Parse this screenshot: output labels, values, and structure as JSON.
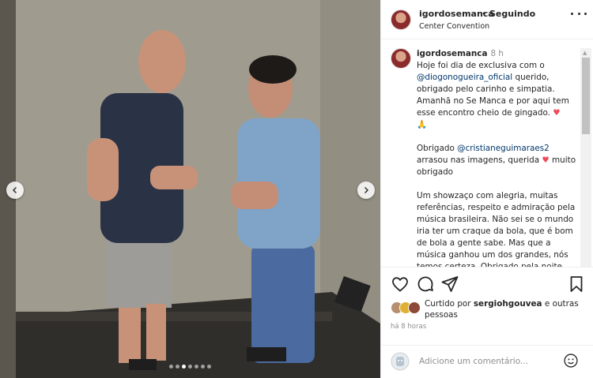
{
  "post": {
    "username": "igordosemanca",
    "separator": "•",
    "follow_status": "Seguindo",
    "location": "Center Convention"
  },
  "caption": {
    "username": "igordosemanca",
    "time": "8 h",
    "line1": "Hoje foi dia de exclusiva com o",
    "mention1": "@diogonogueira_oficial",
    "line2": " querido, obrigado pelo carinho e simpatia. Amanhã no Se Manca e por aqui tem esse encontro cheio de gingado.",
    "emoji_heart": "♥",
    "emoji_pray": "🙏",
    "line3": "Obrigado",
    "mention2": "@cristianeguimaraes2",
    "line4": " arrasou nas imagens, querida",
    "line5": " muito obrigado",
    "line6": "Um showzaço com alegria, muitas referências, respeito e admiração pela música brasileira. Não sei se o mundo iria ter um craque da bola, que é bom de bola a gente sabe. Mas que a música ganhou um dos grandes, nós temos certeza. Obrigado pela noite"
  },
  "likes": {
    "prefix": "Curtido por",
    "user": "sergiohgouvea",
    "suffix": "e outras pessoas"
  },
  "post_time": "há 8 horas",
  "comment": {
    "placeholder": "Adicione um comentário..."
  },
  "carousel": {
    "slide_count": 7,
    "active_index": 2
  },
  "icons": {
    "prev": "chevron-left-icon",
    "next": "chevron-right-icon",
    "like": "heart-outline-icon",
    "comment": "comment-bubble-icon",
    "share": "paper-plane-icon",
    "save": "bookmark-icon",
    "more": "more-dots-icon",
    "emoji": "emoji-avatar-icon",
    "smile": "smile-icon"
  },
  "colors": {
    "link": "#00376b",
    "heart": "#ed4956",
    "muted": "#8e8e8e"
  }
}
